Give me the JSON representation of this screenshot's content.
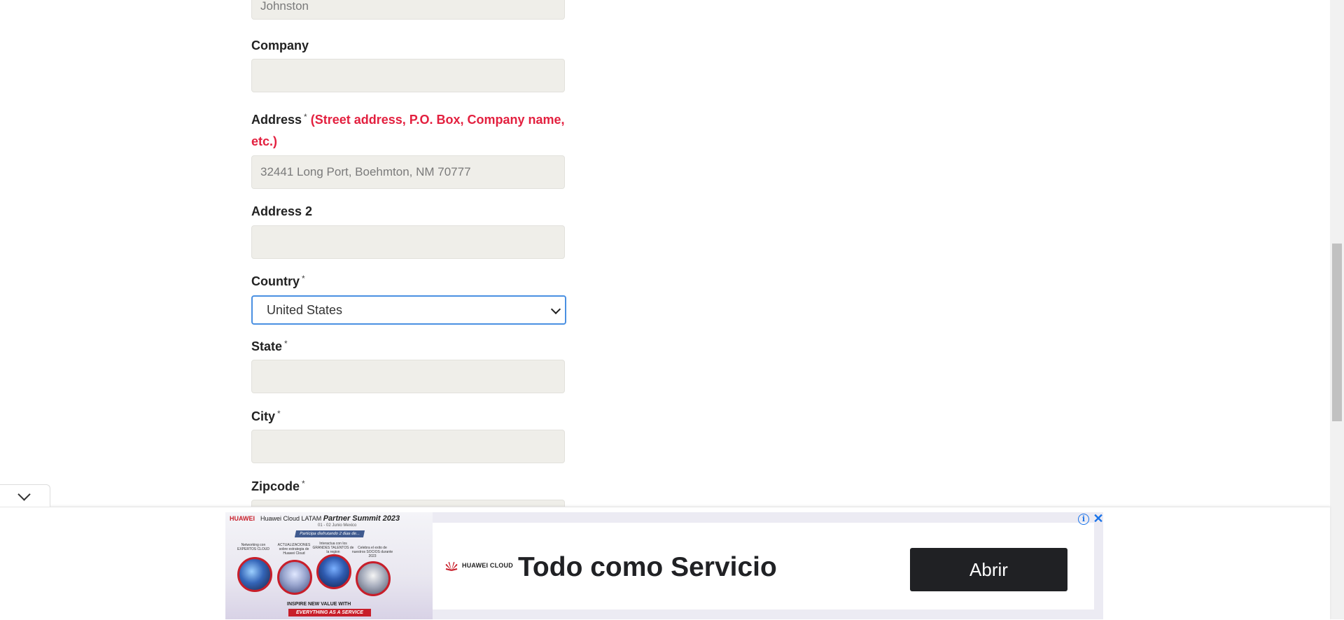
{
  "form": {
    "last_name_value": "Johnston",
    "company_label": "Company",
    "company_value": "",
    "address_label": "Address",
    "address_hint": "(Street address, P.O. Box, Company name, etc.)",
    "address_value": "32441 Long Port, Boehmton, NM 70777",
    "address2_label": "Address 2",
    "address2_value": "",
    "country_label": "Country",
    "country_value": "United States",
    "state_label": "State",
    "state_value": "",
    "city_label": "City",
    "city_value": "",
    "zipcode_label": "Zipcode",
    "required_mark": "*"
  },
  "ad": {
    "left_brand": "HUAWEI",
    "left_title_prefix": "Huawei Cloud LATAM",
    "left_title_event": "Partner Summit 2023",
    "left_subtitle": "01 - 02 Junio Mexico",
    "left_pill": "Participa disfrutando 2 dias de...",
    "captions": [
      "Networking con EXPERTOS CLOUD",
      "ACTUALIZACIONES sobre estrategia de Huawei Cloud",
      "Interactua con los GRANDES TALENTOS de la region",
      "Celebra el exito de nuestros SOCIOS durante 2023"
    ],
    "banner_line1": "INSPIRE NEW VALUE WITH",
    "banner_line2": "EVERYTHING AS A SERVICE",
    "logo_text": "HUAWEI CLOUD",
    "headline": "Todo como Servicio",
    "cta": "Abrir",
    "info_icon": "i",
    "close_icon": "✕"
  },
  "colors": {
    "field_bg": "#efeee9",
    "hint_red": "#e3203f",
    "select_border": "#4a90e2",
    "cta_bg": "#202124"
  }
}
